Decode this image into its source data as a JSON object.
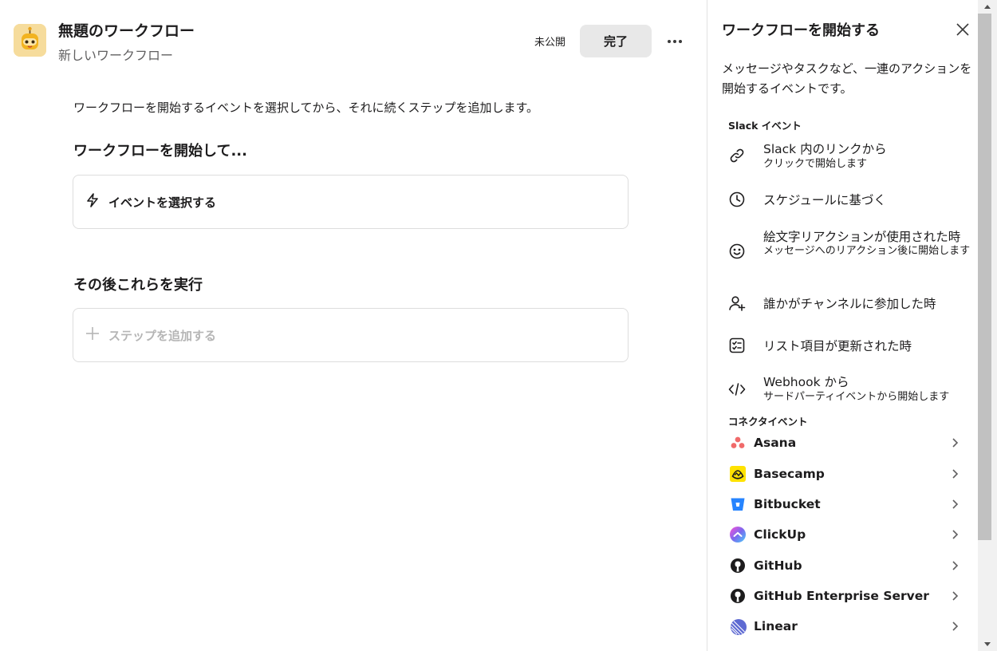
{
  "header": {
    "title": "無題のワークフロー",
    "subtitle": "新しいワークフロー",
    "status": "未公開",
    "done_label": "完了"
  },
  "editor": {
    "intro": "ワークフローを開始するイベントを選択してから、それに続くステップを追加します。",
    "start_title": "ワークフローを開始して...",
    "select_event_label": "イベントを選択する",
    "then_title": "その後これらを実行",
    "add_step_label": "ステップを追加する"
  },
  "panel": {
    "title": "ワークフローを開始する",
    "description": "メッセージやタスクなど、一連のアクションを開始するイベントです。",
    "slack_group": "Slack イベント",
    "slack_events": [
      {
        "title": "Slack 内のリンクから",
        "sub": "クリックで開始します",
        "icon": "link-icon"
      },
      {
        "title": "スケジュールに基づく",
        "sub": "",
        "icon": "clock-icon"
      },
      {
        "title": "絵文字リアクションが使用された時",
        "sub": "メッセージへのリアクション後に開始します",
        "icon": "smile-icon"
      },
      {
        "title": "誰かがチャンネルに参加した時",
        "sub": "",
        "icon": "user-plus-icon"
      },
      {
        "title": "リスト項目が更新された時",
        "sub": "",
        "icon": "list-check-icon"
      },
      {
        "title": "Webhook から",
        "sub": "サードパーティイベントから開始します",
        "icon": "code-icon"
      }
    ],
    "connector_group": "コネクタイベント",
    "connectors": [
      {
        "name": "Asana",
        "icon": "asana-icon"
      },
      {
        "name": "Basecamp",
        "icon": "basecamp-icon"
      },
      {
        "name": "Bitbucket",
        "icon": "bitbucket-icon"
      },
      {
        "name": "ClickUp",
        "icon": "clickup-icon"
      },
      {
        "name": "GitHub",
        "icon": "github-icon"
      },
      {
        "name": "GitHub Enterprise Server",
        "icon": "github-icon"
      },
      {
        "name": "Linear",
        "icon": "linear-icon"
      }
    ]
  },
  "colors": {
    "asana": "#f06a6a",
    "basecamp": "#ffe200",
    "bitbucket": "#2684ff",
    "clickup": "#7b68ee",
    "linear": "#5e6ad2"
  }
}
